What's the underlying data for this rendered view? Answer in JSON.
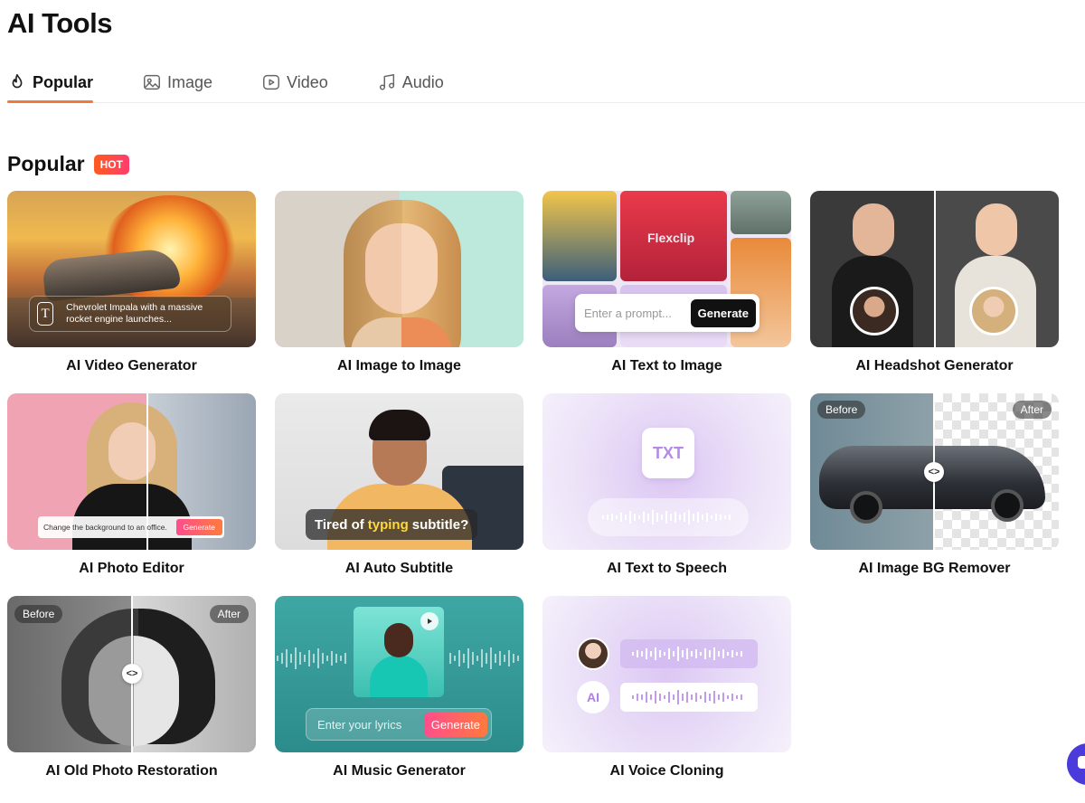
{
  "page": {
    "title": "AI Tools"
  },
  "tabs": [
    {
      "label": "Popular",
      "icon": "flame-icon",
      "active": true
    },
    {
      "label": "Image",
      "icon": "image-icon",
      "active": false
    },
    {
      "label": "Video",
      "icon": "play-circle-icon",
      "active": false
    },
    {
      "label": "Audio",
      "icon": "music-note-icon",
      "active": false
    }
  ],
  "section": {
    "title": "Popular",
    "badge": "HOT"
  },
  "colors": {
    "accent": "#f07a3a",
    "hot_start": "#ff5a1f",
    "hot_end": "#ff3d6e",
    "generate_pink": "#ff4d8d"
  },
  "tools": [
    {
      "label": "AI Video Generator",
      "prompt": "Chevrolet Impala with a massive rocket engine launches...",
      "prompt_icon": "T"
    },
    {
      "label": "AI Image to Image"
    },
    {
      "label": "AI Text to Image",
      "placeholder": "Enter a prompt...",
      "button": "Generate",
      "tile_text": "Flexclip"
    },
    {
      "label": "AI Headshot Generator"
    },
    {
      "label": "AI Photo Editor",
      "edit_text": "Change the background to an office.",
      "button": "Generate"
    },
    {
      "label": "AI Auto Subtitle",
      "caption_pre": "Tired of",
      "caption_hl": "typing",
      "caption_post": "subtitle?"
    },
    {
      "label": "AI Text to Speech",
      "doc_text": "TXT"
    },
    {
      "label": "AI Image BG Remover",
      "before": "Before",
      "after": "After",
      "handle": "<>"
    },
    {
      "label": "AI Old Photo Restoration",
      "before": "Before",
      "after": "After",
      "handle": "<>"
    },
    {
      "label": "AI Music Generator",
      "placeholder": "Enter your lyrics",
      "button": "Generate"
    },
    {
      "label": "AI Voice Cloning",
      "ai_badge": "AI"
    }
  ]
}
